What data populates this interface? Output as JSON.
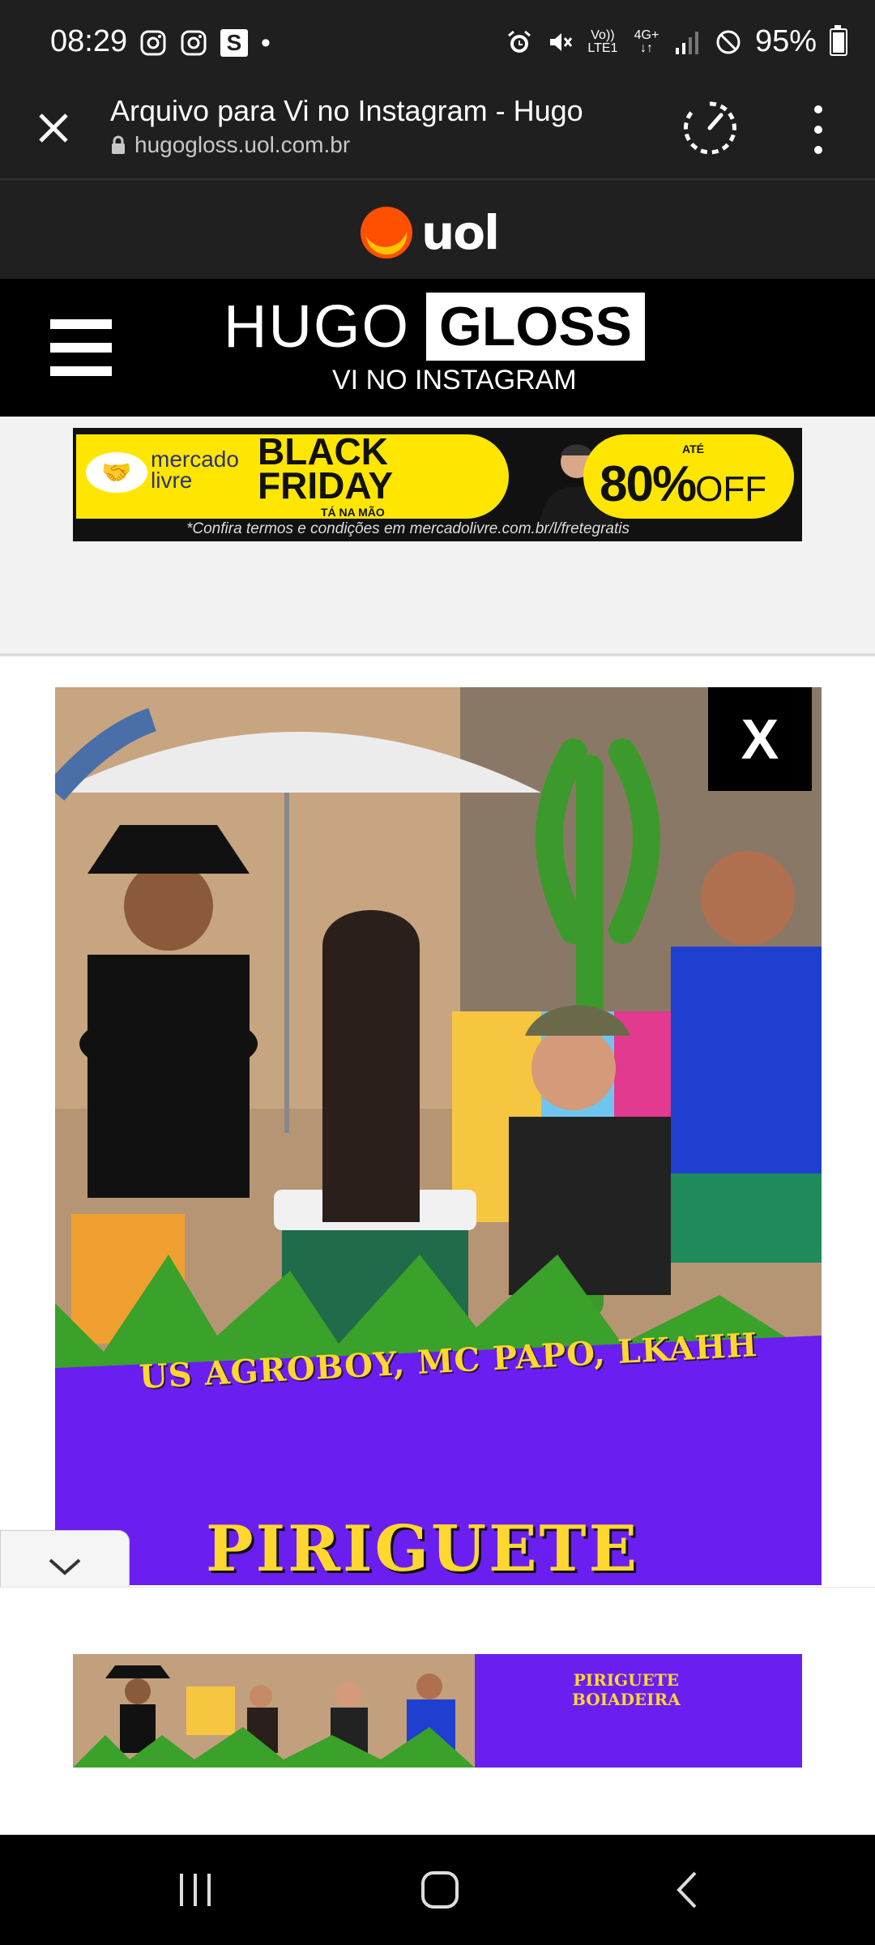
{
  "status_bar": {
    "time": "08:29",
    "battery": "95%",
    "battery_level": 0.95,
    "icons": [
      "instagram-icon",
      "instagram-icon",
      "s-app-icon",
      "alarm-icon",
      "mute-icon",
      "volte-icon",
      "4g-icon",
      "signal-icon",
      "do-not-disturb-icon",
      "battery-icon"
    ],
    "volte_label": "Vo)) LTE1",
    "network_label": "4G+",
    "notification_dot": "•",
    "s_app_label": "S"
  },
  "browser": {
    "title": "Arquivo para Vi no Instagram - Hugo",
    "url": "hugogloss.uol.com.br"
  },
  "uol": {
    "logo_text": "uol",
    "brand_colors": [
      "#ff4f00",
      "#ffc400",
      "#e60000"
    ]
  },
  "site_header": {
    "brand_left": "HUGO",
    "brand_right": "GLOSS",
    "section": "VI NO INSTAGRAM"
  },
  "top_ad": {
    "brand_line1": "mercado",
    "brand_line2": "livre",
    "headline_line1": "BLACK",
    "headline_line2": "FRIDAY",
    "tagline": "TÁ NA MÃO",
    "prefix": "ATÉ",
    "discount": "80%",
    "discount_suffix": "OFF",
    "fine_print": "*Confira termos e condições em mercadolivre.com.br/l/fretegratis",
    "accent": "#ffe600"
  },
  "hero": {
    "close_label": "X",
    "artists": "US AGROBOY, MC PAPO, LKAHH",
    "song_title": "PIRIGUETE",
    "accent_purple": "#6a1ff0",
    "accent_yellow": "#ffd72e"
  },
  "bottom_ad": {
    "title_line1": "PIRIGUETE",
    "title_line2": "BOIADEIRA"
  },
  "nav": {
    "recents": "recents-icon",
    "home": "home-icon",
    "back": "back-icon"
  }
}
